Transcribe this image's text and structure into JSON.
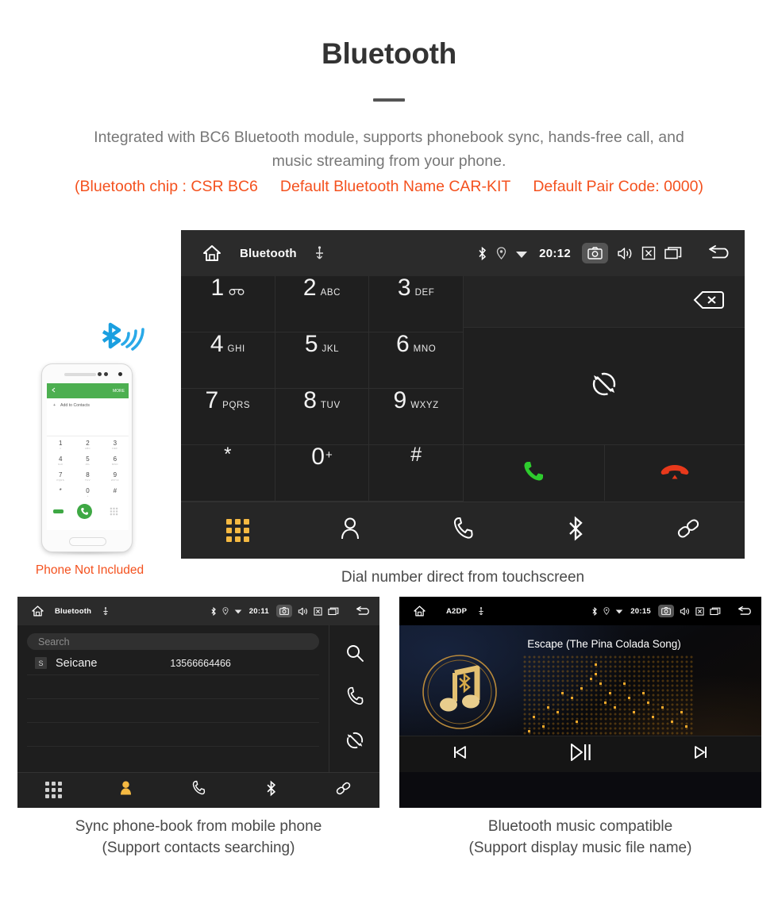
{
  "header": {
    "title": "Bluetooth",
    "intro_line1": "Integrated with BC6 Bluetooth module, supports phonebook sync, hands-free call, and",
    "intro_line2": "music streaming from your phone.",
    "spec_chip": "(Bluetooth chip : CSR BC6",
    "spec_name": "Default Bluetooth Name CAR-KIT",
    "spec_pair": "Default Pair Code: 0000)"
  },
  "colors": {
    "accent_orange": "#f4511e",
    "active_tab": "#f5b942",
    "call_green": "#2ecc2e",
    "hangup_red": "#e8391b",
    "gold": "#d4a24a",
    "bluetooth_blue": "#1a9fe0"
  },
  "dialer": {
    "status": {
      "home_icon": "home-icon",
      "title": "Bluetooth",
      "usb_icon": "usb-icon",
      "bluetooth_icon": "bluetooth-icon",
      "location_icon": "location-icon",
      "wifi_icon": "wifi-icon",
      "time": "20:12",
      "camera_icon": "camera-icon",
      "volume_icon": "volume-icon",
      "close_icon": "close-box-icon",
      "recents_icon": "recents-icon",
      "back_icon": "back-arrow-icon"
    },
    "keys": [
      {
        "num": "1",
        "sub": "",
        "voicemail": true
      },
      {
        "num": "2",
        "sub": "ABC"
      },
      {
        "num": "3",
        "sub": "DEF"
      },
      {
        "num": "4",
        "sub": "GHI"
      },
      {
        "num": "5",
        "sub": "JKL"
      },
      {
        "num": "6",
        "sub": "MNO"
      },
      {
        "num": "7",
        "sub": "PQRS"
      },
      {
        "num": "8",
        "sub": "TUV"
      },
      {
        "num": "9",
        "sub": "WXYZ"
      },
      {
        "num": "*",
        "sub": ""
      },
      {
        "num": "0",
        "sup": "+"
      },
      {
        "num": "#",
        "sub": ""
      }
    ],
    "number_display": "",
    "backspace_icon": "backspace-icon",
    "sync_icon": "sync-icon",
    "call_icon": "call-icon",
    "hangup_icon": "hangup-icon",
    "nav": [
      {
        "icon": "keypad-icon",
        "label": "Keypad",
        "active": true
      },
      {
        "icon": "contacts-icon",
        "label": "Contacts",
        "active": false
      },
      {
        "icon": "call-log-icon",
        "label": "Call log",
        "active": false
      },
      {
        "icon": "bluetooth-icon",
        "label": "Bluetooth",
        "active": false
      },
      {
        "icon": "link-icon",
        "label": "Link",
        "active": false
      }
    ],
    "caption": "Dial number direct from touchscreen"
  },
  "phone_mock": {
    "header_back_icon": "back-arrow-icon",
    "header_more": "MORE",
    "add_to_contacts": "Add to Contacts",
    "keys": [
      {
        "num": "1",
        "sub": "∞"
      },
      {
        "num": "2",
        "sub": "ABC"
      },
      {
        "num": "3",
        "sub": "DEF"
      },
      {
        "num": "4",
        "sub": "GHI"
      },
      {
        "num": "5",
        "sub": "JKL"
      },
      {
        "num": "6",
        "sub": "MNO"
      },
      {
        "num": "7",
        "sub": "PQRS"
      },
      {
        "num": "8",
        "sub": "TUV"
      },
      {
        "num": "9",
        "sub": "WXYZ"
      },
      {
        "num": "*",
        "sub": ""
      },
      {
        "num": "0",
        "sub": "+"
      },
      {
        "num": "#",
        "sub": ""
      }
    ],
    "not_included": "Phone Not Included",
    "signal_icon": "bluetooth-signal-icon"
  },
  "contacts": {
    "status": {
      "title": "Bluetooth",
      "time": "20:11"
    },
    "search_placeholder": "Search",
    "rows": [
      {
        "badge": "S",
        "name": "Seicane",
        "number": "13566664466"
      }
    ],
    "side_actions": [
      {
        "icon": "search-icon",
        "label": "Search"
      },
      {
        "icon": "call-icon",
        "label": "Call"
      },
      {
        "icon": "sync-icon",
        "label": "Sync"
      }
    ],
    "nav": [
      {
        "icon": "keypad-icon",
        "label": "Keypad",
        "active": false
      },
      {
        "icon": "contacts-icon",
        "label": "Contacts",
        "active": true
      },
      {
        "icon": "call-log-icon",
        "label": "Call log",
        "active": false
      },
      {
        "icon": "bluetooth-icon",
        "label": "Bluetooth",
        "active": false
      },
      {
        "icon": "link-icon",
        "label": "Link",
        "active": false
      }
    ],
    "caption_line1": "Sync phone-book from mobile phone",
    "caption_line2": "(Support contacts searching)"
  },
  "music": {
    "status": {
      "title": "A2DP",
      "time": "20:15"
    },
    "track_title": "Escape (The Pina Colada Song)",
    "album_icon": "music-note-bluetooth-icon",
    "controls": [
      {
        "icon": "previous-track-icon",
        "label": "Previous"
      },
      {
        "icon": "play-pause-icon",
        "label": "Play / Pause"
      },
      {
        "icon": "next-track-icon",
        "label": "Next"
      }
    ],
    "caption_line1": "Bluetooth music compatible",
    "caption_line2": "(Support display music file name)"
  }
}
